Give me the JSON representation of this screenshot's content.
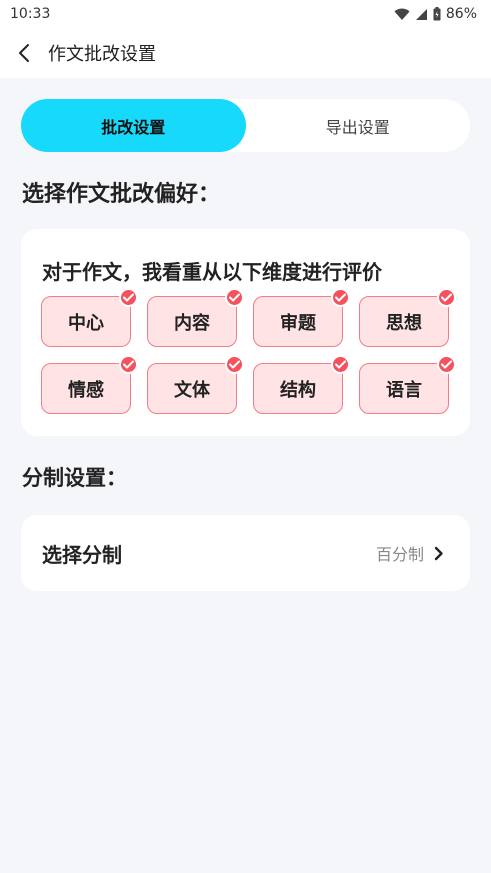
{
  "status": {
    "time": "10:33",
    "battery": "86%"
  },
  "header": {
    "title": "作文批改设置"
  },
  "tabs": [
    {
      "label": "批改设置",
      "active": true
    },
    {
      "label": "导出设置",
      "active": false
    }
  ],
  "preference": {
    "section_title": "选择作文批改偏好：",
    "heading": "对于作文，我看重从以下维度进行评价",
    "dimensions": [
      {
        "label": "中心",
        "selected": true
      },
      {
        "label": "内容",
        "selected": true
      },
      {
        "label": "审题",
        "selected": true
      },
      {
        "label": "思想",
        "selected": true
      },
      {
        "label": "情感",
        "selected": true
      },
      {
        "label": "文体",
        "selected": true
      },
      {
        "label": "结构",
        "selected": true
      },
      {
        "label": "语言",
        "selected": true
      }
    ]
  },
  "scoring": {
    "section_title": "分制设置：",
    "row_label": "选择分制",
    "row_value": "百分制"
  },
  "colors": {
    "accent": "#16d9fb",
    "chip_bg": "#ffe3e5",
    "chip_border": "#f07d87",
    "check": "#f4525f"
  }
}
